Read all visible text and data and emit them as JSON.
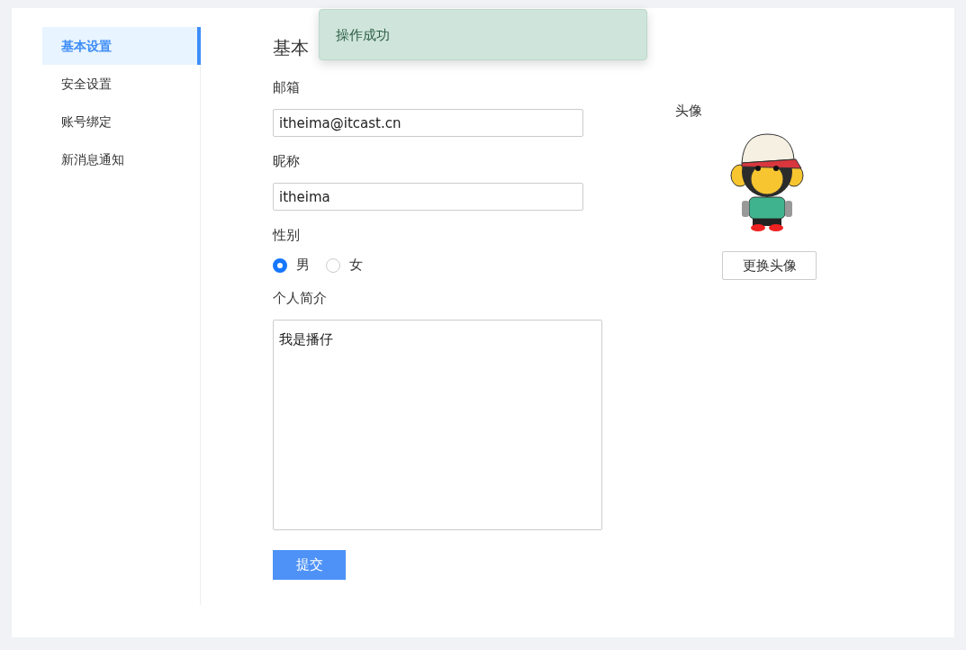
{
  "sidebar": {
    "items": [
      {
        "label": "基本设置",
        "selected": true
      },
      {
        "label": "安全设置",
        "selected": false
      },
      {
        "label": "账号绑定",
        "selected": false
      },
      {
        "label": "新消息通知",
        "selected": false
      }
    ]
  },
  "title": "基本",
  "form": {
    "email": {
      "label": "邮箱",
      "value": "itheima@itcast.cn"
    },
    "nickname": {
      "label": "昵称",
      "value": "itheima"
    },
    "gender": {
      "label": "性别",
      "options": [
        {
          "label": "男",
          "selected": true
        },
        {
          "label": "女",
          "selected": false
        }
      ]
    },
    "bio": {
      "label": "个人简介",
      "value": "我是播仔"
    },
    "submit": "提交"
  },
  "avatar": {
    "label": "头像",
    "button": "更换头像"
  },
  "toast": {
    "message": "操作成功"
  }
}
